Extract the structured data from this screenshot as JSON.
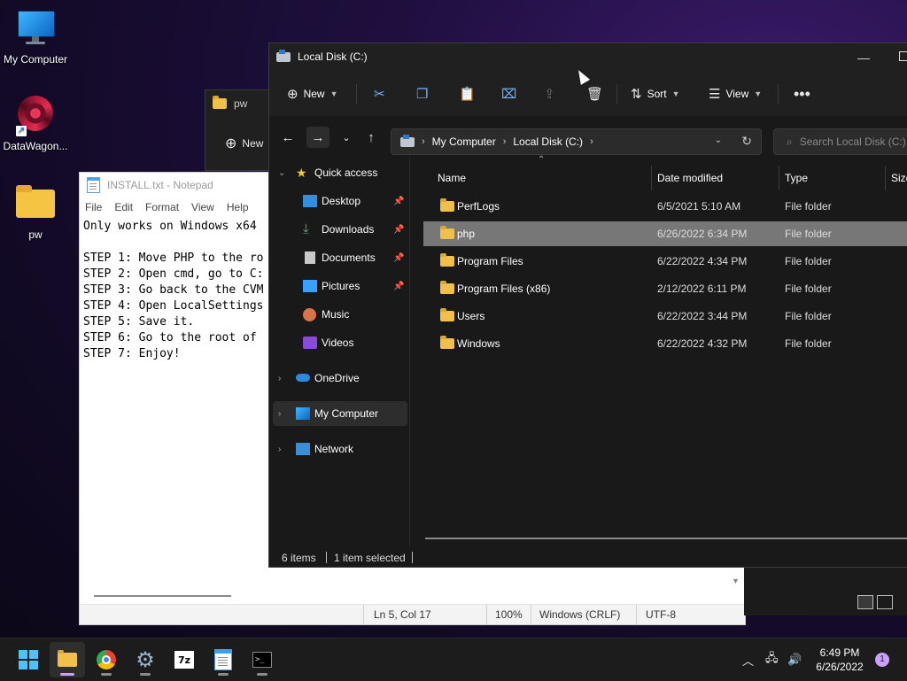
{
  "desktop": {
    "icons": [
      {
        "label": "My Computer"
      },
      {
        "label": "DataWagon..."
      },
      {
        "label": "pw"
      }
    ]
  },
  "background_window": {
    "title": "pw",
    "new_label": "New"
  },
  "notepad": {
    "title": "INSTALL.txt - Notepad",
    "menu": [
      "File",
      "Edit",
      "Format",
      "View",
      "Help"
    ],
    "content": "Only works on Windows x64\n\nSTEP 1: Move PHP to the ro\nSTEP 2: Open cmd, go to C:\nSTEP 3: Go back to the CVM\nSTEP 4: Open LocalSettings\nSTEP 5: Save it.\nSTEP 6: Go to the root of \nSTEP 7: Enjoy!",
    "status": {
      "position": "Ln 5, Col 17",
      "zoom": "100%",
      "line_endings": "Windows (CRLF)",
      "encoding": "UTF-8"
    }
  },
  "explorer": {
    "title": "Local Disk (C:)",
    "toolbar": {
      "new_label": "New",
      "sort_label": "Sort",
      "view_label": "View"
    },
    "address": {
      "crumbs": [
        "My Computer",
        "Local Disk (C:)"
      ]
    },
    "search_placeholder": "Search Local Disk (C:)",
    "nav": {
      "quick_access": "Quick access",
      "items": [
        {
          "label": "Desktop",
          "pinned": true
        },
        {
          "label": "Downloads",
          "pinned": true
        },
        {
          "label": "Documents",
          "pinned": true
        },
        {
          "label": "Pictures",
          "pinned": true
        },
        {
          "label": "Music",
          "pinned": false
        },
        {
          "label": "Videos",
          "pinned": false
        }
      ],
      "onedrive": "OneDrive",
      "my_computer": "My Computer",
      "network": "Network"
    },
    "columns": {
      "name": "Name",
      "date": "Date modified",
      "type": "Type",
      "size": "Size"
    },
    "files": [
      {
        "name": "PerfLogs",
        "date": "6/5/2021 5:10 AM",
        "type": "File folder",
        "selected": false
      },
      {
        "name": "php",
        "date": "6/26/2022 6:34 PM",
        "type": "File folder",
        "selected": true
      },
      {
        "name": "Program Files",
        "date": "6/22/2022 4:34 PM",
        "type": "File folder",
        "selected": false
      },
      {
        "name": "Program Files (x86)",
        "date": "2/12/2022 6:11 PM",
        "type": "File folder",
        "selected": false
      },
      {
        "name": "Users",
        "date": "6/22/2022 3:44 PM",
        "type": "File folder",
        "selected": false
      },
      {
        "name": "Windows",
        "date": "6/22/2022 4:32 PM",
        "type": "File folder",
        "selected": false
      }
    ],
    "status": {
      "items": "6 items",
      "selected": "1 item selected"
    }
  },
  "taskbar": {
    "time": "6:49 PM",
    "date": "6/26/2022",
    "notifications": "1"
  }
}
